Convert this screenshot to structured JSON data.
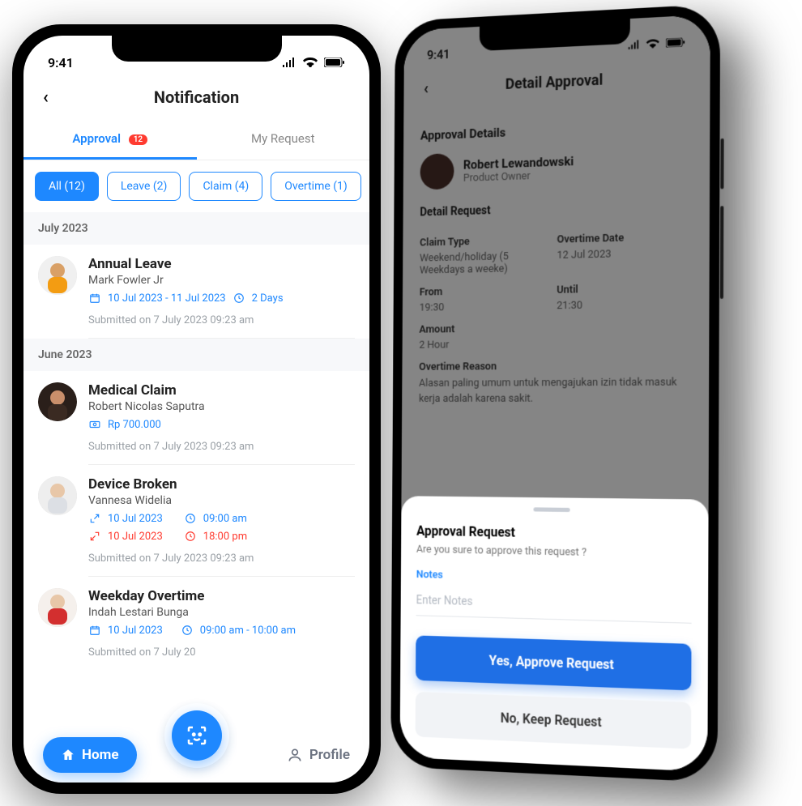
{
  "phone1": {
    "status": {
      "time": "9:41"
    },
    "header": {
      "title": "Notification"
    },
    "tabs": {
      "approval": {
        "label": "Approval",
        "badge": "12"
      },
      "my_request": {
        "label": "My Request"
      }
    },
    "filters": {
      "all": "All (12)",
      "leave": "Leave (2)",
      "claim": "Claim (4)",
      "overtime": "Overtime (1)"
    },
    "sections": {
      "july": {
        "label": "July 2023"
      },
      "june": {
        "label": "June 2023"
      }
    },
    "items": {
      "annual_leave": {
        "title": "Annual Leave",
        "name": "Mark Fowler Jr",
        "date_range": "10 Jul 2023 - 11 Jul 2023",
        "duration": "2 Days",
        "submitted": "Submitted on 7 July 2023 09:23 am"
      },
      "medical_claim": {
        "title": "Medical Claim",
        "name": "Robert Nicolas Saputra",
        "amount": "Rp 700.000",
        "submitted": "Submitted on 7 July 2023 09:23 am"
      },
      "device_broken": {
        "title": "Device Broken",
        "name": "Vannesa Widelia",
        "date_in": "10 Jul 2023",
        "time_in": "09:00 am",
        "date_out": "10 Jul 2023",
        "time_out": "18:00 pm",
        "submitted": "Submitted on 7 July 2023 09:23 am"
      },
      "weekday_overtime": {
        "title": "Weekday Overtime",
        "name": "Indah Lestari Bunga",
        "date": "10 Jul 2023",
        "time_range": "09:00 am - 10:00 am",
        "submitted": "Submitted on 7 July 20"
      }
    },
    "bottom": {
      "home": "Home",
      "profile": "Profile"
    }
  },
  "phone2": {
    "status": {
      "time": "9:41"
    },
    "header": {
      "title": "Detail Approval"
    },
    "section_title": "Approval Details",
    "person": {
      "name": "Robert Lewandowski",
      "role": "Product Owner"
    },
    "detail_label": "Detail Request",
    "fields": {
      "claim_type": {
        "label": "Claim Type",
        "value": "Weekend/holiday (5 Weekdays a weeke)"
      },
      "overtime_date": {
        "label": "Overtime Date",
        "value": "12 Jul 2023"
      },
      "from": {
        "label": "From",
        "value": "19:30"
      },
      "until": {
        "label": "Until",
        "value": "21:30"
      },
      "amount": {
        "label": "Amount",
        "value": "2 Hour"
      },
      "reason": {
        "label": "Overtime Reason",
        "value": "Alasan paling umum untuk mengajukan izin tidak masuk kerja adalah karena sakit."
      }
    },
    "sheet": {
      "title": "Approval Request",
      "question": "Are you sure to approve this request ?",
      "notes_label": "Notes",
      "notes_placeholder": "Enter Notes",
      "yes": "Yes, Approve Request",
      "no": "No, Keep Request"
    }
  }
}
